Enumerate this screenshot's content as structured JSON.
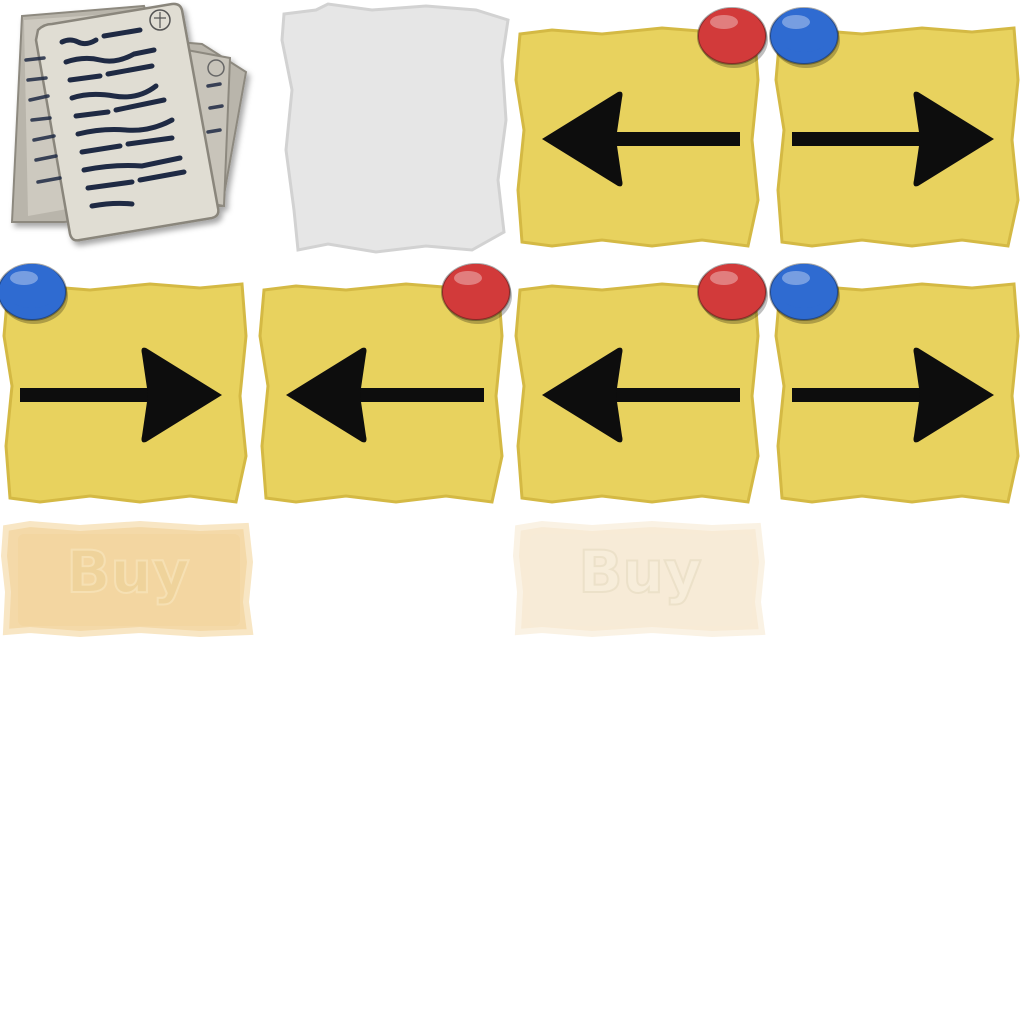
{
  "sprites": [
    {
      "id": "documents",
      "name": "document-stack-icon",
      "kind": "documents"
    },
    {
      "id": "blank",
      "name": "blank-paper-sheet",
      "kind": "blank-sheet"
    },
    {
      "id": "note-1",
      "name": "sticky-note-left-arrow-red-pin",
      "kind": "note",
      "arrow": "left",
      "pin": "red",
      "pin_side": "right"
    },
    {
      "id": "note-2",
      "name": "sticky-note-right-arrow-blue-pin",
      "kind": "note",
      "arrow": "right",
      "pin": "blue",
      "pin_side": "left"
    },
    {
      "id": "note-3",
      "name": "sticky-note-right-arrow-blue-pin",
      "kind": "note",
      "arrow": "right",
      "pin": "blue",
      "pin_side": "left"
    },
    {
      "id": "note-4",
      "name": "sticky-note-left-arrow-red-pin",
      "kind": "note",
      "arrow": "left",
      "pin": "red",
      "pin_side": "right"
    },
    {
      "id": "note-5",
      "name": "sticky-note-left-arrow-red-pin",
      "kind": "note",
      "arrow": "left",
      "pin": "red",
      "pin_side": "right"
    },
    {
      "id": "note-6",
      "name": "sticky-note-right-arrow-blue-pin",
      "kind": "note",
      "arrow": "right",
      "pin": "blue",
      "pin_side": "left"
    }
  ],
  "buy_buttons": [
    {
      "id": "buy-1",
      "label": "Buy",
      "state": "normal"
    },
    {
      "id": "buy-2",
      "label": "Buy",
      "state": "disabled"
    }
  ],
  "colors": {
    "note_yellow": "#e8d25e",
    "note_yellow_edge": "#d4b944",
    "pin_red": "#d23a3a",
    "pin_blue": "#2f6bd1",
    "arrow": "#0d0d0d",
    "paper_grey": "#e6e6e6",
    "doc_paper": "#d9d6cc",
    "doc_ink": "#1f2a44",
    "buy_bg": "#f4d9a8",
    "buy_text": "#efd39b"
  }
}
